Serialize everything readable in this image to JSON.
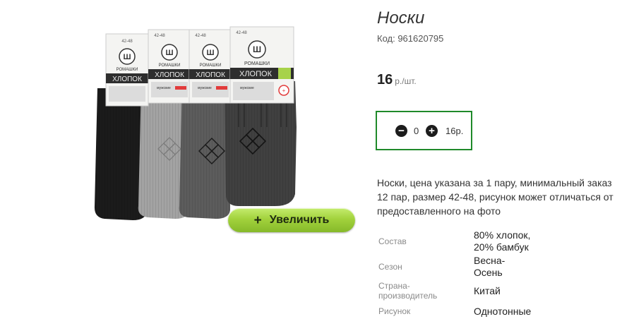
{
  "product": {
    "title": "Носки",
    "code": "Код: 961620795",
    "price_value": "16",
    "price_unit": "р./шт.",
    "description": "Носки, цена указана за 1 пару, минимальный заказ 12 пар, размер 42-48, рисунок может отличаться от предоставленного на фото"
  },
  "image": {
    "zoom_label": "Увеличить",
    "packaging": {
      "brand": "РОМАШКИ",
      "band_text": "ХЛОПОК",
      "sublabel": "мужские",
      "size": "42-48"
    }
  },
  "quantity": {
    "value": "0",
    "total": "16р."
  },
  "specs": [
    {
      "key": "Состав",
      "value_lines": [
        "80% хлопок,",
        "20% бамбук"
      ]
    },
    {
      "key": "Сезон",
      "value_lines": [
        "Весна-",
        "Осень"
      ]
    },
    {
      "key_lines": [
        "Страна-",
        "производитель"
      ],
      "value": "Китай"
    },
    {
      "key": "Рисунок",
      "value": "Однотонные"
    }
  ],
  "colors": {
    "accent_border": "#1f8a2a",
    "zoom_button": "#a2d23c",
    "sock_colors": [
      "#1b1b1b",
      "#a3a3a3",
      "#5c5c5c",
      "#404040"
    ]
  }
}
